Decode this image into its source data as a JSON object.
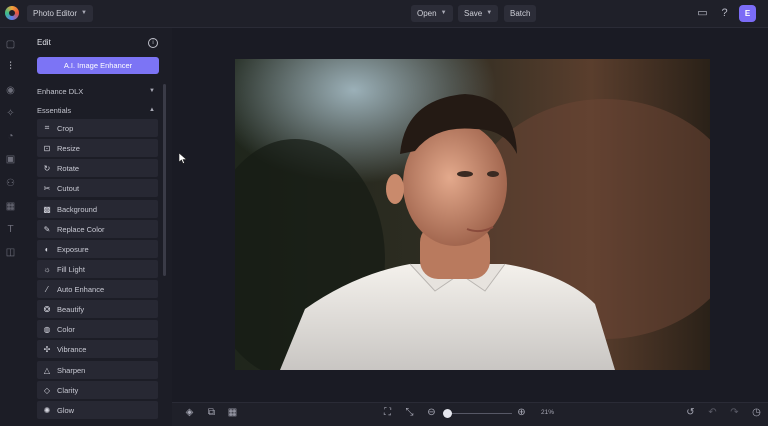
{
  "topbar": {
    "app_menu_label": "Photo Editor",
    "open_label": "Open",
    "save_label": "Save",
    "batch_label": "Batch",
    "avatar_letter": "E"
  },
  "panel": {
    "title": "Edit",
    "ai_button_label": "A.I. Image Enhancer",
    "enhance_dlx_label": "Enhance DLX",
    "essentials_label": "Essentials",
    "tools": [
      {
        "label": "Crop",
        "icon": "crop-icon"
      },
      {
        "label": "Resize",
        "icon": "resize-icon"
      },
      {
        "label": "Rotate",
        "icon": "rotate-icon"
      },
      {
        "label": "Cutout",
        "icon": "scissors-icon"
      },
      {
        "label": "Background",
        "icon": "background-icon"
      },
      {
        "label": "Replace Color",
        "icon": "dropper-icon"
      },
      {
        "label": "Exposure",
        "icon": "exposure-icon"
      },
      {
        "label": "Fill Light",
        "icon": "light-icon"
      },
      {
        "label": "Auto Enhance",
        "icon": "wand-icon"
      },
      {
        "label": "Beautify",
        "icon": "beautify-icon"
      },
      {
        "label": "Color",
        "icon": "color-icon"
      },
      {
        "label": "Vibrance",
        "icon": "vibrance-icon"
      },
      {
        "label": "Sharpen",
        "icon": "triangle-icon"
      },
      {
        "label": "Clarity",
        "icon": "diamond-icon"
      },
      {
        "label": "Glow",
        "icon": "glow-icon"
      }
    ]
  },
  "bottombar": {
    "zoom_percent_label": "21%",
    "zoom_value": 21
  },
  "colors": {
    "accent": "#7c74f5",
    "background": "#1c1d26",
    "panel_item": "#272833"
  }
}
